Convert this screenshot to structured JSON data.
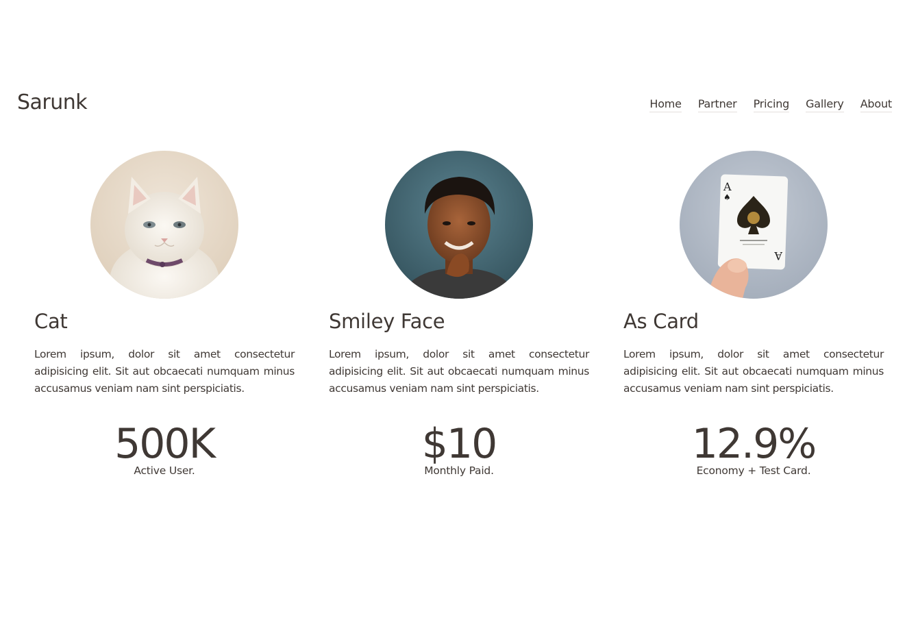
{
  "brand": "Sarunk",
  "nav": [
    "Home",
    "Partner",
    "Pricing",
    "Gallery",
    "About"
  ],
  "cards": [
    {
      "image": "cat-photo",
      "title": "Cat",
      "text": "Lorem ipsum, dolor sit amet consectetur adipisicing elit. Sit aut obcaecati numquam minus accusamus veniam nam sint perspiciatis.",
      "stat_value": "500K",
      "stat_label": "Active User."
    },
    {
      "image": "smiling-person-photo",
      "title": "Smiley Face",
      "text": "Lorem ipsum, dolor sit amet consectetur adipisicing elit. Sit aut obcaecati numquam minus accusamus veniam nam sint perspiciatis.",
      "stat_value": "$10",
      "stat_label": "Monthly Paid."
    },
    {
      "image": "ace-of-spades-card-photo",
      "title": "As Card",
      "text": "Lorem ipsum, dolor sit amet consectetur adipisicing elit. Sit aut obcaecati numquam minus accusamus veniam nam sint perspiciatis.",
      "stat_value": "12.9%",
      "stat_label": "Economy + Test Card."
    }
  ],
  "colors": {
    "text": "#3f3834",
    "background": "#ffffff",
    "nav_underline": "#e3dedb"
  }
}
